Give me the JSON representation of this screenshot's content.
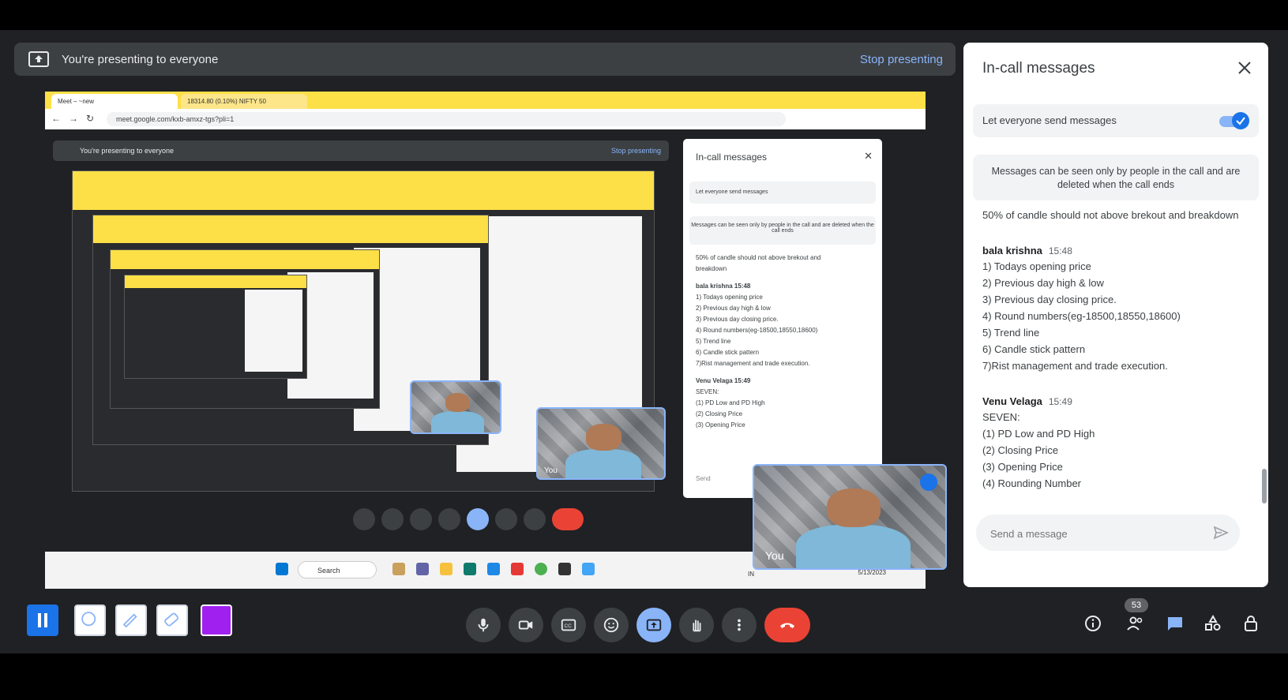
{
  "banner": {
    "text": "You're presenting to everyone",
    "stop_label": "Stop presenting"
  },
  "shared_screen": {
    "tabs": [
      "Meet – ~new",
      "18314.80 (0.10%) NIFTY 50"
    ],
    "url": "meet.google.com/kxb-amxz-tgs?pli=1",
    "inner_banner": "You're presenting to everyone",
    "inner_stop": "Stop presenting",
    "inner_panel_title": "In-call messages",
    "inner_toggle_label": "Let everyone send messages",
    "inner_notice": "Messages can be seen only by people in the call and are deleted when the call ends",
    "inner_lines": [
      "50% of candle should not above brekout and",
      "breakdown",
      "bala krishna  15:48",
      "1) Todays opening price",
      "2) Previous day high & low",
      "3) Previous day closing price.",
      "4) Round numbers(eg-18500,18550,18600)",
      "5) Trend line",
      "6) Candle stick pattern",
      "7)Rist management and trade execution.",
      "Venu Velaga  15:49",
      "SEVEN:",
      "(1) PD Low and PD High",
      "(2) Closing Price",
      "(3) Opening Price"
    ],
    "inner_send_placeholder": "Send",
    "taskbar_search": "Search",
    "taskbar_date": "5/13/2023",
    "taskbar_lang": "IN",
    "self_label": "You"
  },
  "panel": {
    "title": "In-call messages",
    "toggle_label": "Let everyone send messages",
    "notice": "Messages can be seen only by people in the call and are deleted when the call ends",
    "fragment": "50% of candle should not above brekout and breakdown",
    "messages": [
      {
        "sender": "bala krishna",
        "time": "15:48",
        "lines": [
          "1) Todays opening price",
          "2) Previous day high & low",
          "3) Previous day closing price.",
          "4) Round numbers(eg-18500,18550,18600)",
          "5) Trend line",
          "6) Candle stick pattern",
          "7)Rist management and trade execution."
        ]
      },
      {
        "sender": "Venu Velaga",
        "time": "15:49",
        "lines": [
          "SEVEN:",
          "(1) PD Low and PD High",
          "(2) Closing Price",
          "(3) Opening Price",
          "(4) Rounding Number"
        ]
      }
    ],
    "send_placeholder": "Send a message"
  },
  "bottom": {
    "participant_count": "53",
    "icons": [
      "mic-icon",
      "camera-icon",
      "captions-icon",
      "emoji-icon",
      "present-icon",
      "raise-hand-icon",
      "more-icon",
      "end-call-icon",
      "info-icon",
      "people-icon",
      "chat-icon",
      "activities-icon",
      "host-controls-icon"
    ]
  },
  "colors": {
    "background": "#202124",
    "accent": "#8ab4f8",
    "primary": "#1a73e8",
    "end_call": "#ea4335",
    "recorder_color": "#a020f0"
  }
}
